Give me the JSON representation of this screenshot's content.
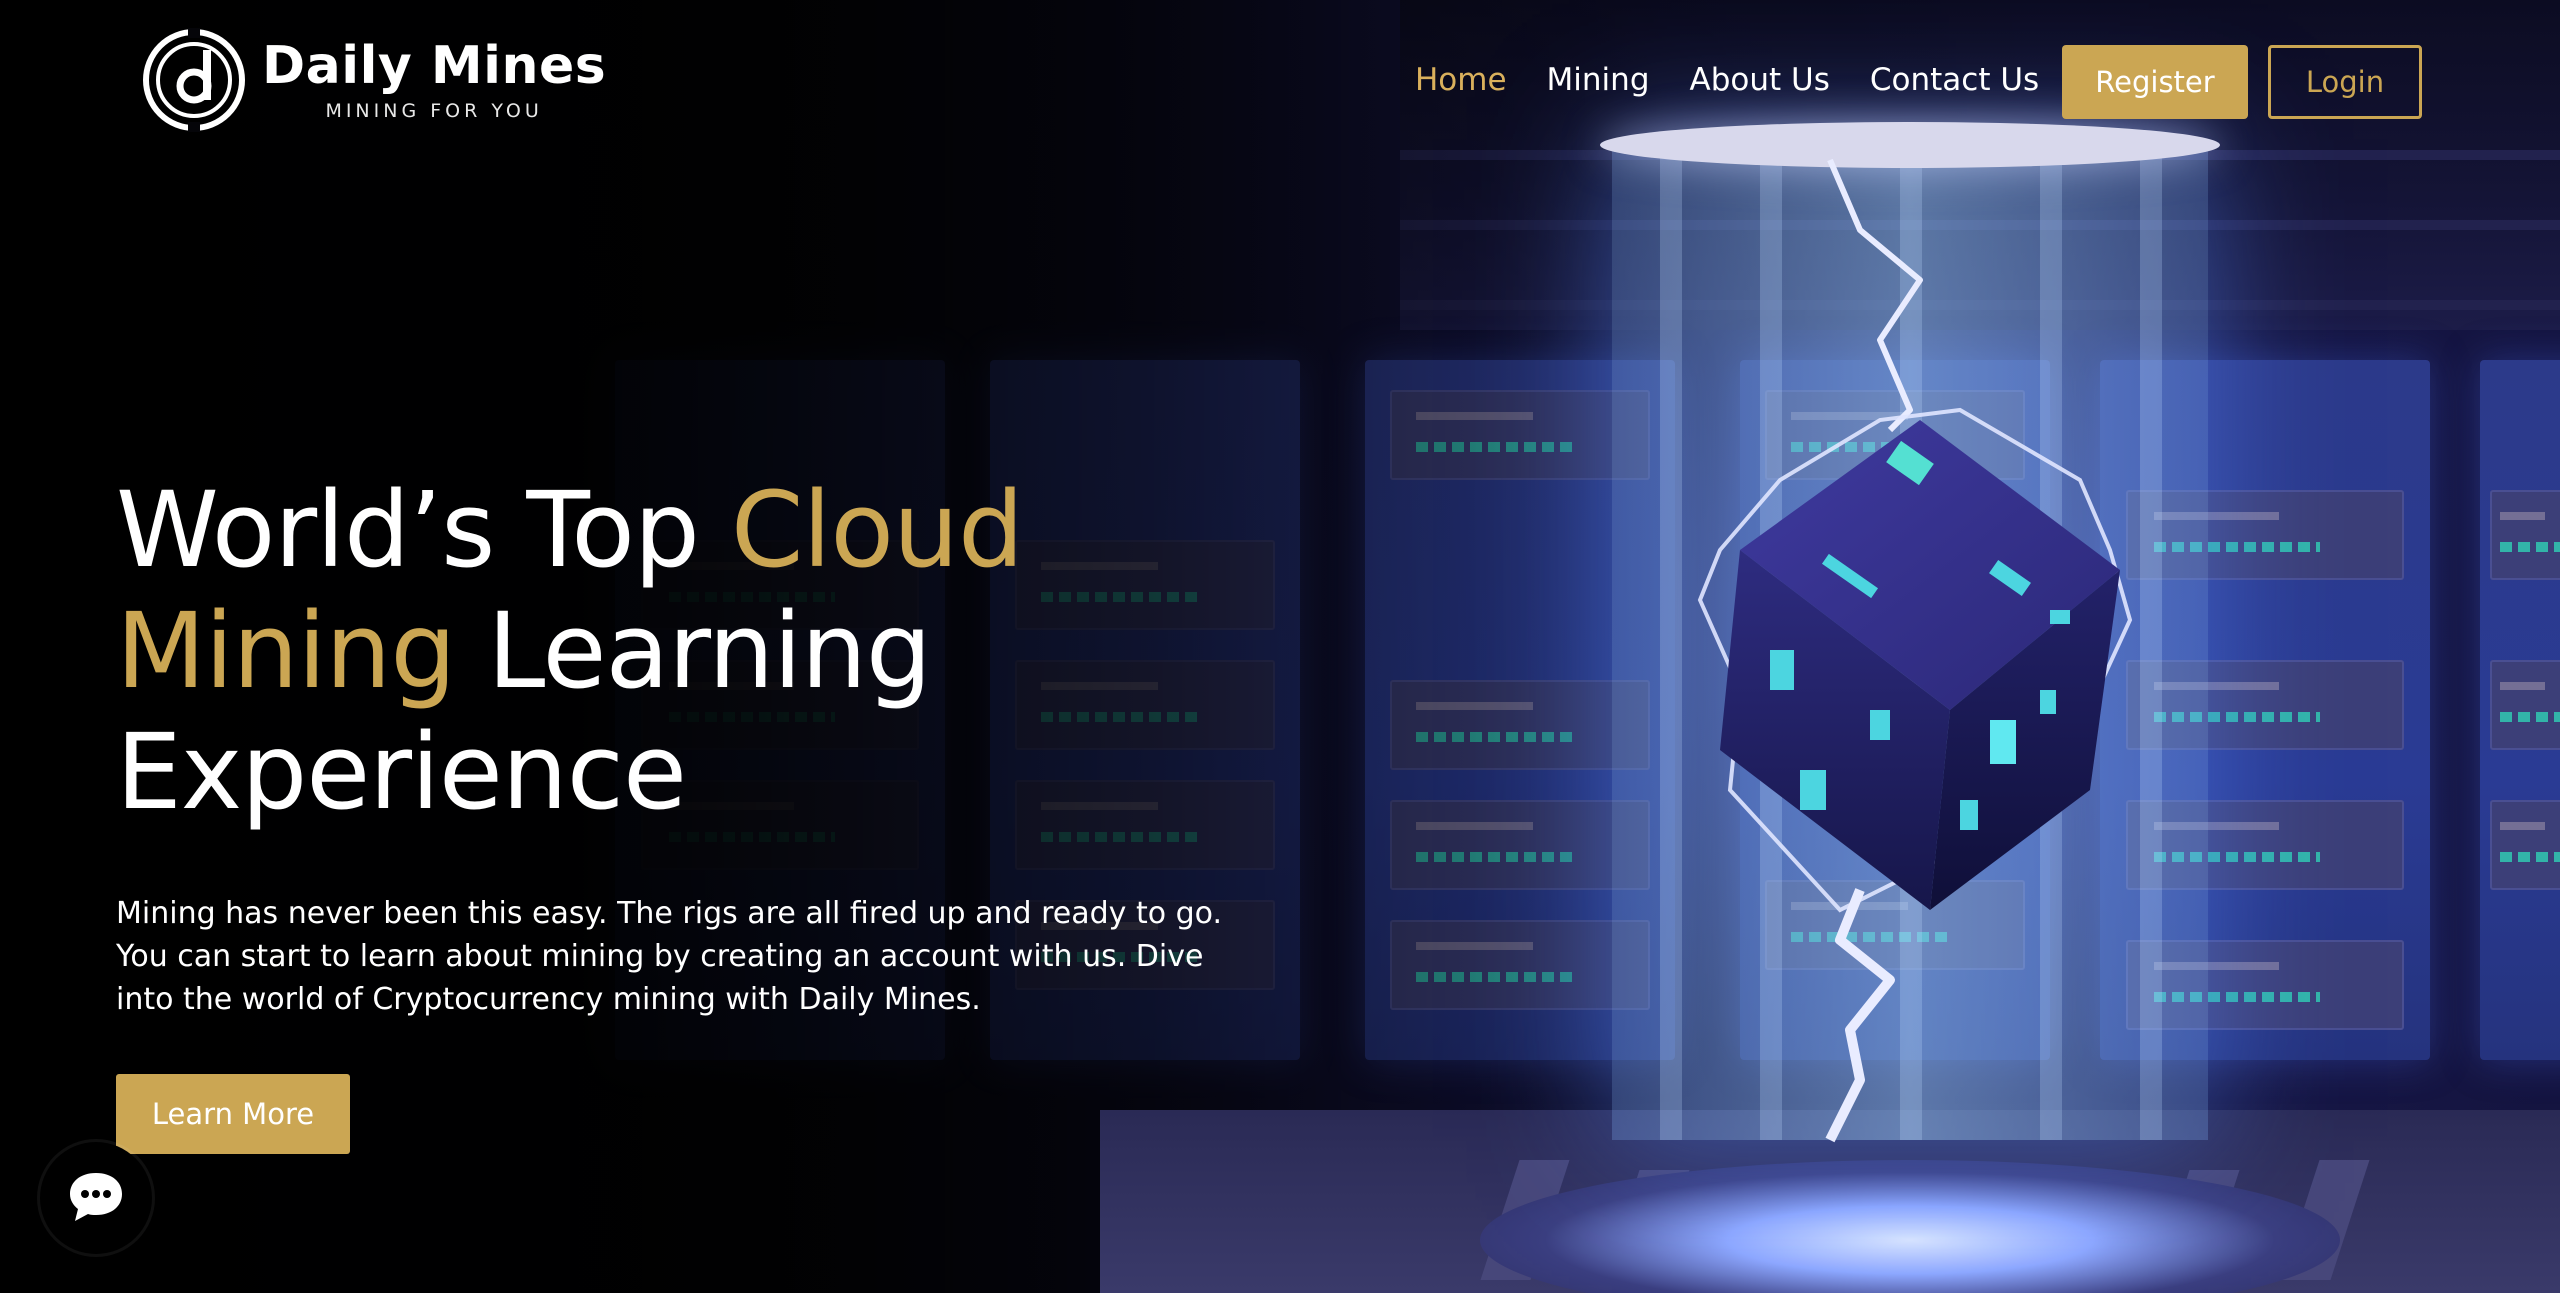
{
  "brand": {
    "name": "Daily Mines",
    "tagline": "MINING FOR YOU",
    "logo_icon": "coin-d-logo-icon"
  },
  "nav": {
    "items": [
      {
        "label": "Home",
        "active": true
      },
      {
        "label": "Mining",
        "active": false
      },
      {
        "label": "About Us",
        "active": false
      },
      {
        "label": "Contact Us",
        "active": false
      }
    ],
    "register_label": "Register",
    "login_label": "Login"
  },
  "hero": {
    "title_part1": "World’s Top ",
    "title_highlight1": "Cloud",
    "title_highlight2": "Mining",
    "title_part2": " Learning",
    "title_part3": "Experience",
    "description": "Mining has never been this easy. The rigs are all fired up and ready to go. You can start to learn about mining by creating an account with us. Dive into the world of Cryptocurrency mining with Daily Mines.",
    "cta_label": "Learn More"
  },
  "chat": {
    "icon": "chat-bubble-icon"
  },
  "colors": {
    "accent_gold": "#cba653",
    "nav_active": "#d9b05c",
    "text_white": "#ffffff",
    "background": "#050509"
  }
}
